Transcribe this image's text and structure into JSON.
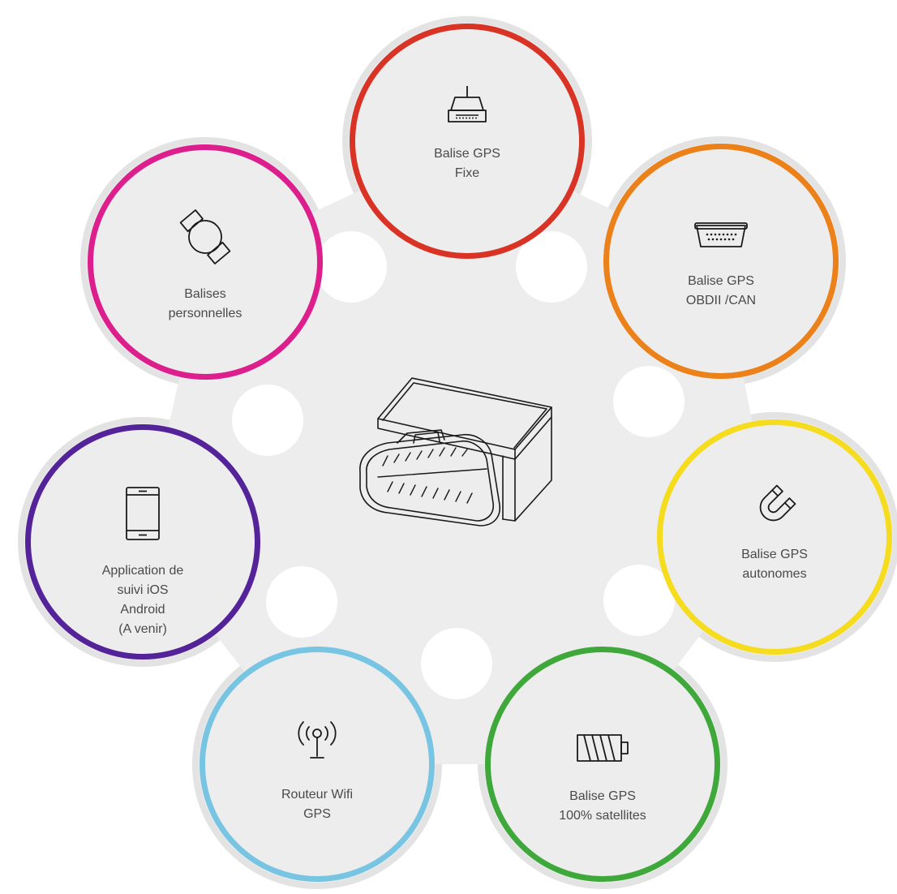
{
  "nodes": [
    {
      "id": "fixe",
      "color": "#d93325",
      "icon": "router-icon",
      "lines": [
        "Balise GPS",
        "Fixe"
      ]
    },
    {
      "id": "obd",
      "color": "#ec8019",
      "icon": "obd-connector-icon",
      "lines": [
        "Balise GPS",
        "OBDII /CAN"
      ]
    },
    {
      "id": "perso",
      "color": "#dc1f8c",
      "icon": "watch-icon",
      "lines": [
        "Balises",
        "personnelles"
      ]
    },
    {
      "id": "app",
      "color": "#54239a",
      "icon": "smartphone-icon",
      "lines": [
        "Application de",
        "suivi iOS",
        "Android",
        "(A venir)"
      ]
    },
    {
      "id": "auto",
      "color": "#f5dc1e",
      "icon": "magnet-icon",
      "lines": [
        "Balise GPS",
        "autonomes"
      ]
    },
    {
      "id": "wifi",
      "color": "#78c5e3",
      "icon": "antenna-icon",
      "lines": [
        "Routeur Wifi",
        "GPS"
      ]
    },
    {
      "id": "sat",
      "color": "#3fa83a",
      "icon": "battery-icon",
      "lines": [
        "Balise GPS",
        "100% satellites"
      ]
    }
  ],
  "center": {
    "icon": "obd-gps-tracker-icon"
  },
  "colors": {
    "background_blob": "#ededed",
    "halo": "#e4e4e4",
    "text": "#4a4a4a",
    "stroke": "#1a1a1a"
  }
}
